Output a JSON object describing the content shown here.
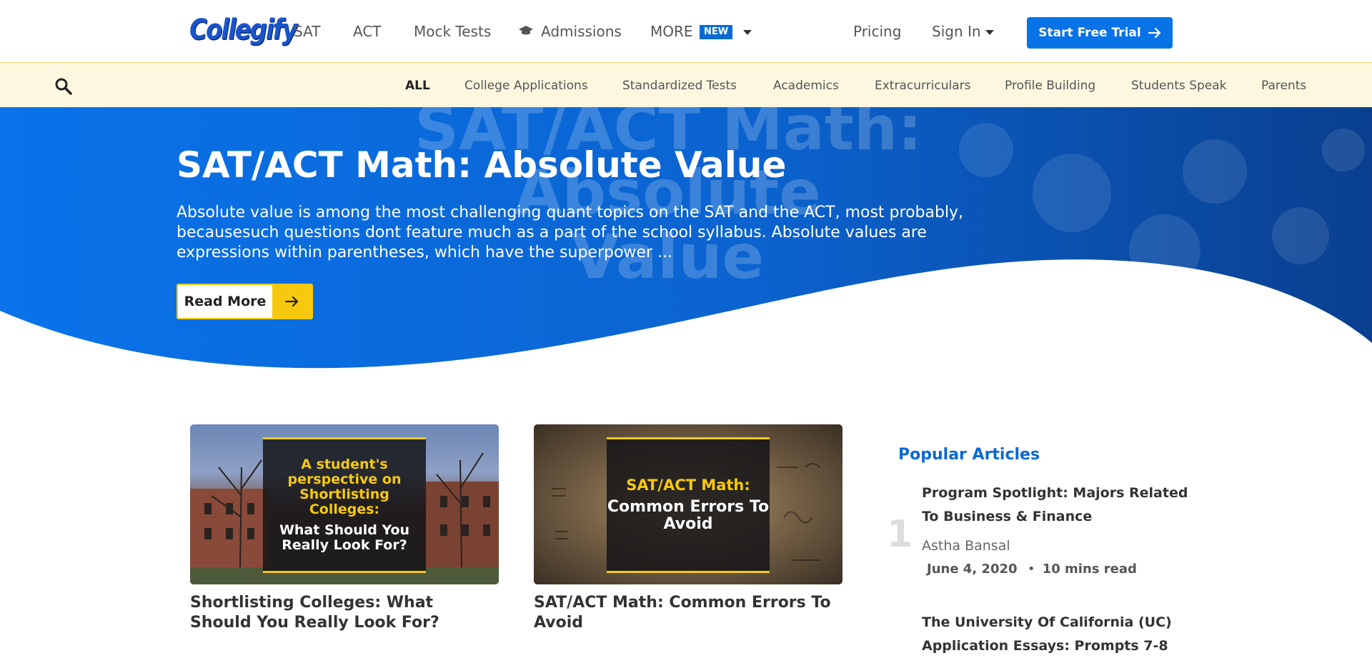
{
  "brand": {
    "logo_text": "Collegify",
    "accent": "#0873e6",
    "yellow": "#f6c90e"
  },
  "topnav": {
    "links": [
      "SAT",
      "ACT",
      "Mock Tests",
      "Admissions",
      "MORE"
    ],
    "new_badge": "NEW",
    "pricing": "Pricing",
    "sign_in": "Sign In",
    "cta": "Start Free Trial"
  },
  "categories": {
    "items": [
      "ALL",
      "College Applications",
      "Standardized Tests",
      "Academics",
      "Extracurriculars",
      "Profile Building",
      "Students Speak",
      "Parents"
    ],
    "active": "ALL"
  },
  "hero": {
    "bg_text": [
      "SAT/ACT Math:",
      "Absolute",
      "Value"
    ],
    "title": "SAT/ACT Math: Absolute Value",
    "description": "Absolute value is among the most challenging quant topics on the SAT and the ACT, most probably, becausesuch questions dont feature much as a part of the school syllabus. Absolute values are expressions within parentheses, which have the superpower ...",
    "button": "Read More"
  },
  "cards": [
    {
      "thumb_yellow": "A student's perspective on Shortlisting Colleges:",
      "thumb_white": "What Should You Really Look For?",
      "title": "Shortlisting Colleges: What Should You Really Look For?"
    },
    {
      "thumb_yellow": "SAT/ACT Math:",
      "thumb_white": "Common Errors To Avoid",
      "title": "SAT/ACT Math: Common Errors To Avoid"
    }
  ],
  "popular": {
    "heading": "Popular Articles",
    "items": [
      {
        "rank": "1",
        "title": "Program Spotlight: Majors Related To Business & Finance",
        "author": "Astha Bansal",
        "date": "June 4, 2020",
        "read_time": "10 mins read"
      },
      {
        "title": "The University Of California (UC) Application Essays: Prompts 7-8"
      }
    ]
  }
}
